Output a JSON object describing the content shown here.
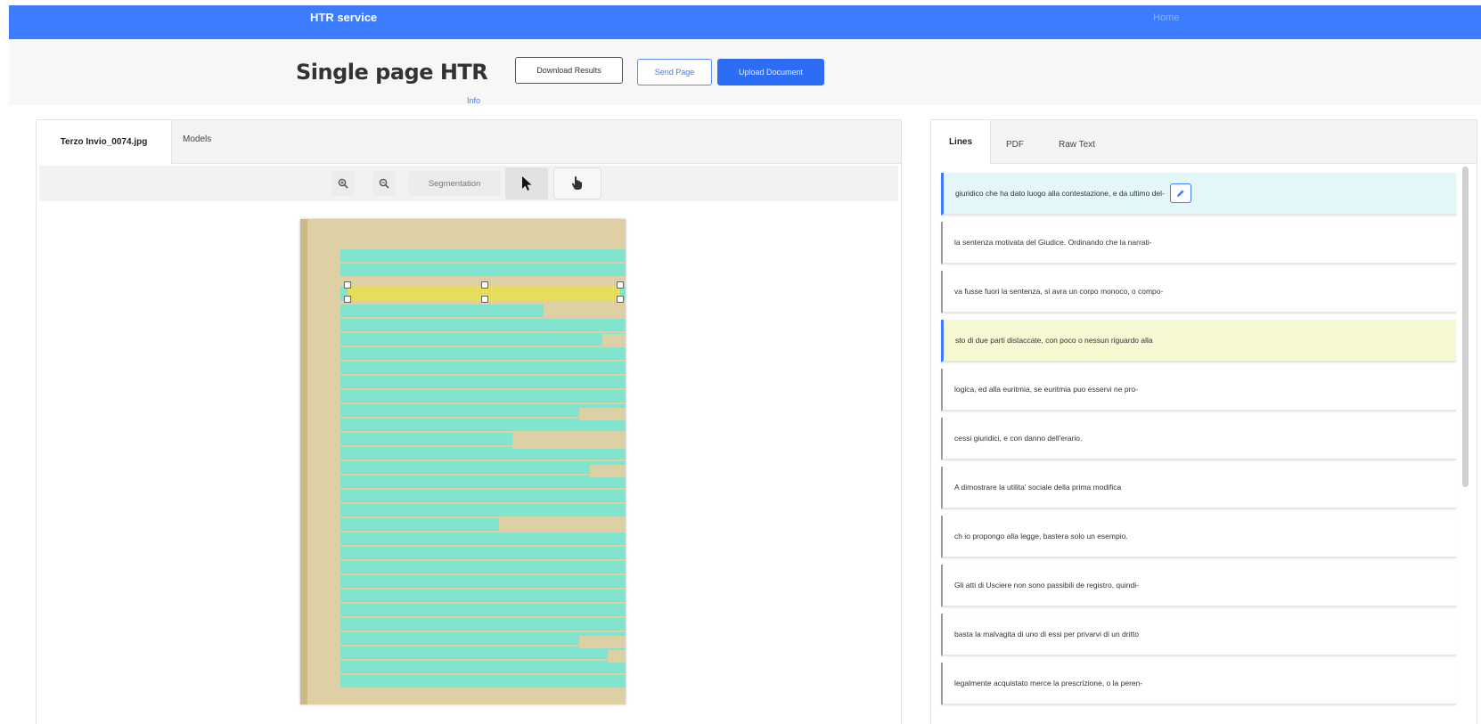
{
  "navbar": {
    "brand": "HTR service",
    "home": "Home"
  },
  "header": {
    "title": "Single page HTR",
    "info": "Info",
    "download_label": "Download Results",
    "send_label": "Send Page",
    "upload_label": "Upload Document"
  },
  "left": {
    "tabs": [
      "Terzo Invio_0074.jpg",
      "Models"
    ],
    "toolbar": {
      "segmentation_label": "Segmentation"
    }
  },
  "right": {
    "tabs": [
      "Lines",
      "PDF",
      "Raw Text"
    ],
    "lines": [
      "giuridico che ha dato luogo alla contestazione, e da ultimo del-",
      "la sentenza motivata del Giudice. Ordinando che la narrati-",
      "va fusse fuori la sentenza, si avra un corpo monoco, o compo-",
      "sto di due parti distaccate, con poco o nessun riguardo alla",
      "logica, ed alla euritmia, se euritmia puo esservi ne pro-",
      "cessi giuridici, e con danno dell'erario.",
      "A dimostrare la utilita' sociale della prima modifica",
      "ch io propongo alla legge, bastera solo un esempio.",
      "Gli atti di Usciere non sono passibili de registro, quindi-",
      "basta la malvagita di uno di essi per privarvi di un dritto",
      "legalmente acquistato merce la prescrizione, o la peren-"
    ]
  }
}
